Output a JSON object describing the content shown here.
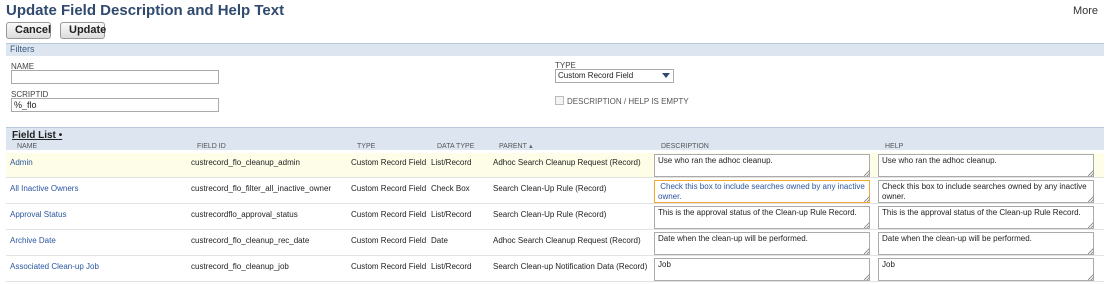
{
  "header": {
    "title": "Update Field Description and Help Text",
    "more_label": "More"
  },
  "toolbar": {
    "cancel_label": "Cancel",
    "update_label": "Update"
  },
  "filters": {
    "section_label": "Filters",
    "name_label": "NAME",
    "name_value": "",
    "scriptid_label": "SCRIPTID",
    "scriptid_value": "%_flo",
    "type_label": "TYPE",
    "type_selected": "Custom Record Field",
    "empty_label": "DESCRIPTION / HELP IS EMPTY"
  },
  "field_list": {
    "title": "Field List",
    "title_marker": "•",
    "columns": [
      "NAME",
      "FIELD ID",
      "TYPE",
      "DATA TYPE",
      "PARENT",
      "DESCRIPTION",
      "HELP"
    ],
    "sort_indicator": "▲",
    "rows": [
      {
        "name": "Admin",
        "field_id": "custrecord_flo_cleanup_admin",
        "type": "Custom Record Field",
        "data_type": "List/Record",
        "parent": "Adhoc Search Cleanup Request (Record)",
        "description": "Use who ran the adhoc cleanup.",
        "help": "Use who ran the adhoc cleanup."
      },
      {
        "name": "All Inactive Owners",
        "field_id": "custrecord_flo_filter_all_inactive_owner",
        "type": "Custom Record Field",
        "data_type": "Check Box",
        "parent": "Search Clean-Up Rule (Record)",
        "description": " Check this box to include searches owned by any inactive owner.",
        "help": "Check this box to include searches owned by any inactive owner."
      },
      {
        "name": "Approval Status",
        "field_id": "custrecordflo_approval_status",
        "type": "Custom Record Field",
        "data_type": "List/Record",
        "parent": "Search Clean-Up Rule (Record)",
        "description": "This is the approval status of the Clean-up Rule Record.",
        "help": "This is the approval status of the Clean-up Rule Record."
      },
      {
        "name": "Archive Date",
        "field_id": "custrecord_flo_cleanup_rec_date",
        "type": "Custom Record Field",
        "data_type": "Date",
        "parent": "Adhoc Search Cleanup Request (Record)",
        "description": "Date when the clean-up will be performed.",
        "help": "Date when the clean-up will be performed."
      },
      {
        "name": "Associated Clean-up Job",
        "field_id": "custrecord_flo_cleanup_job",
        "type": "Custom Record Field",
        "data_type": "List/Record",
        "parent": "Search Clean-up Notification Data (Record)",
        "description": "Job",
        "help": "Job"
      }
    ]
  }
}
